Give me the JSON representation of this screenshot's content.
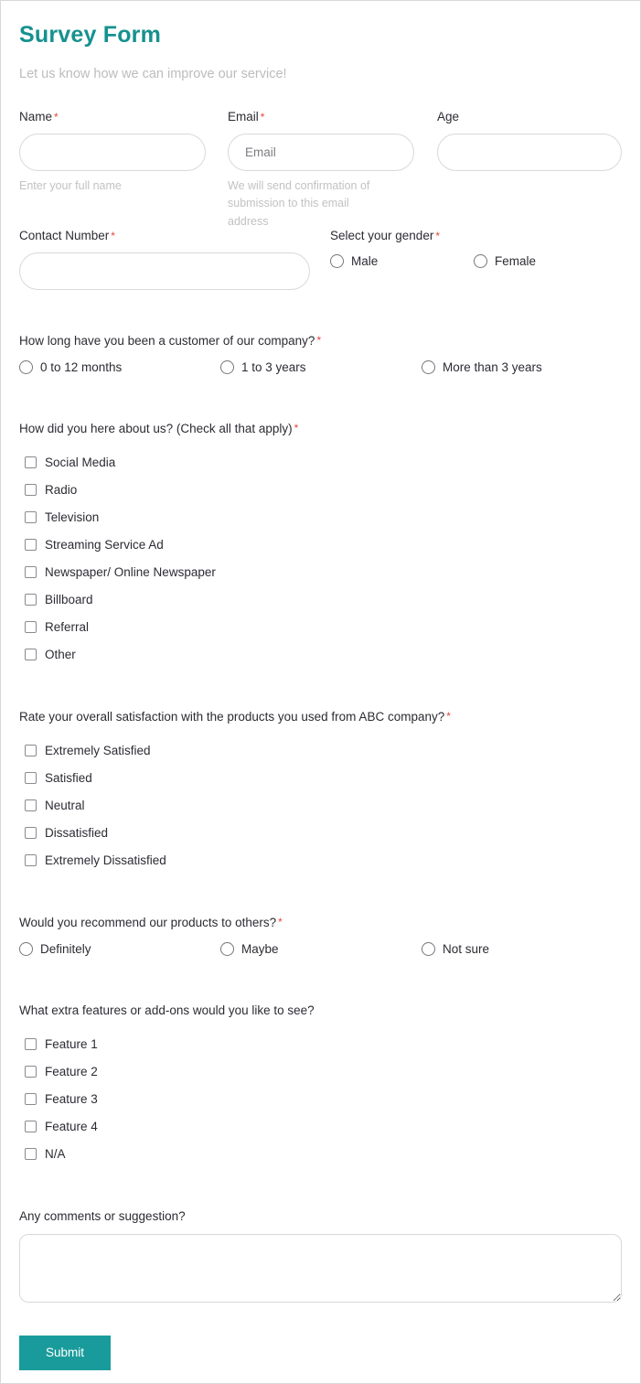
{
  "header": {
    "title": "Survey Form",
    "subtitle": "Let us know how we can improve our service!"
  },
  "colors": {
    "accent": "#16918f",
    "button": "#1a9b9b",
    "required": "#e8453c",
    "subtitle": "#bcbcbc",
    "border": "#d9d9d9"
  },
  "required_marker": "*",
  "fields": {
    "name": {
      "label": "Name",
      "required": true,
      "value": "",
      "placeholder": "",
      "help": "Enter your full name"
    },
    "email": {
      "label": "Email",
      "required": true,
      "value": "",
      "placeholder": "Email",
      "help": "We will send confirmation of submission to this email address"
    },
    "age": {
      "label": "Age",
      "required": false,
      "value": "",
      "placeholder": ""
    },
    "contact_number": {
      "label": "Contact Number",
      "required": true,
      "value": "",
      "placeholder": ""
    }
  },
  "gender": {
    "label": "Select your gender",
    "required": true,
    "options": [
      {
        "label": "Male",
        "selected": false
      },
      {
        "label": "Female",
        "selected": false
      }
    ]
  },
  "tenure": {
    "label": "How long have you been a customer of our company?",
    "required": true,
    "options": [
      {
        "label": "0 to 12 months",
        "selected": false
      },
      {
        "label": "1 to 3 years",
        "selected": false
      },
      {
        "label": "More than 3 years",
        "selected": false
      }
    ]
  },
  "hear_about": {
    "label": "How did you here about us? (Check all that apply)",
    "required": true,
    "options": [
      {
        "label": "Social Media",
        "checked": false
      },
      {
        "label": "Radio",
        "checked": false
      },
      {
        "label": "Television",
        "checked": false
      },
      {
        "label": "Streaming Service Ad",
        "checked": false
      },
      {
        "label": "Newspaper/ Online Newspaper",
        "checked": false
      },
      {
        "label": "Billboard",
        "checked": false
      },
      {
        "label": "Referral",
        "checked": false
      },
      {
        "label": "Other",
        "checked": false
      }
    ]
  },
  "satisfaction": {
    "label": "Rate your overall satisfaction with the products you used from ABC company?",
    "required": true,
    "options": [
      {
        "label": "Extremely Satisfied",
        "checked": false
      },
      {
        "label": "Satisfied",
        "checked": false
      },
      {
        "label": "Neutral",
        "checked": false
      },
      {
        "label": "Dissatisfied",
        "checked": false
      },
      {
        "label": "Extremely Dissatisfied",
        "checked": false
      }
    ]
  },
  "recommend": {
    "label": "Would you recommend our products to others?",
    "required": true,
    "options": [
      {
        "label": "Definitely",
        "selected": false
      },
      {
        "label": "Maybe",
        "selected": false
      },
      {
        "label": "Not sure",
        "selected": false
      }
    ]
  },
  "extra_features": {
    "label": "What extra features or add-ons would you like to see?",
    "required": false,
    "options": [
      {
        "label": "Feature 1",
        "checked": false
      },
      {
        "label": "Feature 2",
        "checked": false
      },
      {
        "label": "Feature 3",
        "checked": false
      },
      {
        "label": "Feature 4",
        "checked": false
      },
      {
        "label": "N/A",
        "checked": false
      }
    ]
  },
  "comments": {
    "label": "Any comments or suggestion?",
    "value": "",
    "placeholder": ""
  },
  "submit": {
    "label": "Submit"
  }
}
